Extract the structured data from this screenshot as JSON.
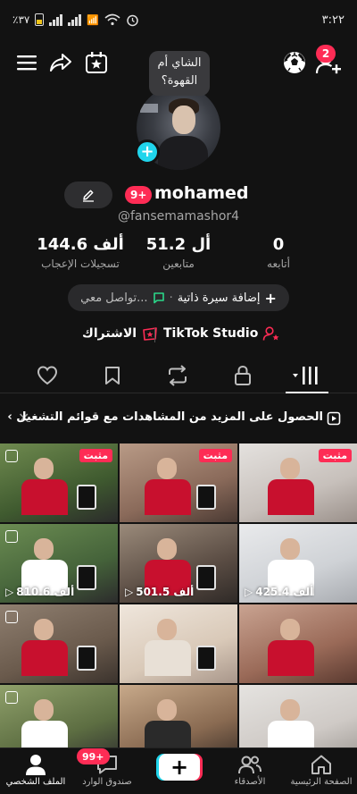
{
  "status_bar": {
    "time": "٣:٢٢",
    "battery": "٪٣٧"
  },
  "header": {
    "notification_count": "2"
  },
  "profile": {
    "note": "الشاي أم القهوة؟",
    "message_badge": "9+",
    "username": "mohamed",
    "handle": "@fansemamashor4"
  },
  "stats": {
    "following_value": "0",
    "following_label": "أتابعه",
    "followers_value": "51.2 أل",
    "followers_label": "متابعين",
    "likes_value": "144.6 ألف",
    "likes_label": "تسجيلات الإعجاب"
  },
  "bio": {
    "add_bio": "إضافة سيرة ذاتية",
    "separator": "·",
    "contact": "تواصل معي..."
  },
  "links": {
    "studio": "TikTok Studio",
    "subscription": "الاشتراك"
  },
  "banner": {
    "text": "الحصول على المزيد من المشاهدات مع قوائم التشغيل"
  },
  "grid": {
    "pinned_label": "مثبت",
    "items": [
      {
        "pinned": true,
        "views": ""
      },
      {
        "pinned": true,
        "views": ""
      },
      {
        "pinned": true,
        "views": ""
      },
      {
        "pinned": false,
        "views": "810.6 ألف"
      },
      {
        "pinned": false,
        "views": "501.5 ألف"
      },
      {
        "pinned": false,
        "views": "425.4 ألف"
      },
      {
        "pinned": false,
        "views": ""
      },
      {
        "pinned": false,
        "views": ""
      },
      {
        "pinned": false,
        "views": ""
      },
      {
        "pinned": false,
        "views": ""
      },
      {
        "pinned": false,
        "views": ""
      },
      {
        "pinned": false,
        "views": ""
      }
    ]
  },
  "bottom_nav": {
    "home": "الصفحة الرئيسية",
    "friends": "الأصدقاء",
    "inbox": "صندوق الوارد",
    "inbox_badge": "99+",
    "profile": "الملف الشخصي"
  },
  "colors": {
    "accent": "#fe2c55",
    "cyan": "#20d5ec",
    "background": "#121212"
  }
}
